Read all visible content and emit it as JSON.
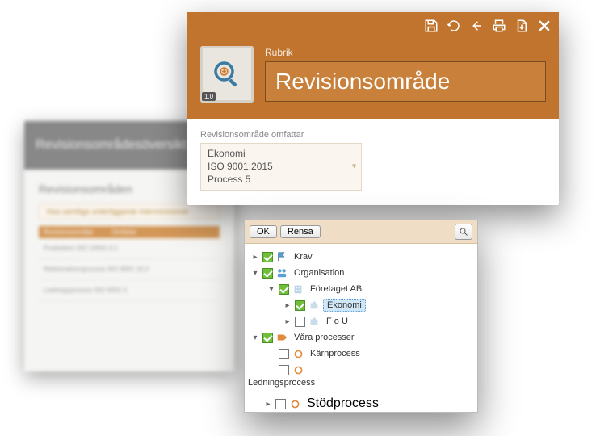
{
  "overview": {
    "title": "Revisionsområdesöversikt",
    "section": "Revisionsområden",
    "note": "Visa samtliga underliggande internrevisioner",
    "columns": [
      "Revisionsområde",
      "Omfattar"
    ],
    "rows": [
      "Produktion ISO 14001 6.1",
      "Reklamationsprocess ISO 9001 10.2",
      "Ledningsprocess ISO 9001 5"
    ]
  },
  "editor": {
    "version": "1.0",
    "rubrik_label": "Rubrik",
    "rubrik_value": "Revisionsområde",
    "omfattar_label": "Revisionsområde omfattar",
    "omfattar_values": [
      "Ekonomi",
      "ISO 9001:2015",
      "Process 5"
    ]
  },
  "tree": {
    "ok": "OK",
    "clear": "Rensa",
    "nodes": {
      "krav": "Krav",
      "org": "Organisation",
      "foretaget": "Företaget AB",
      "ekonomi": "Ekonomi",
      "fou": "F o U",
      "processer": "Våra processer",
      "karn": "Kärnprocess",
      "ledning": "Ledningsprocess",
      "stod": "Stödprocess"
    }
  }
}
